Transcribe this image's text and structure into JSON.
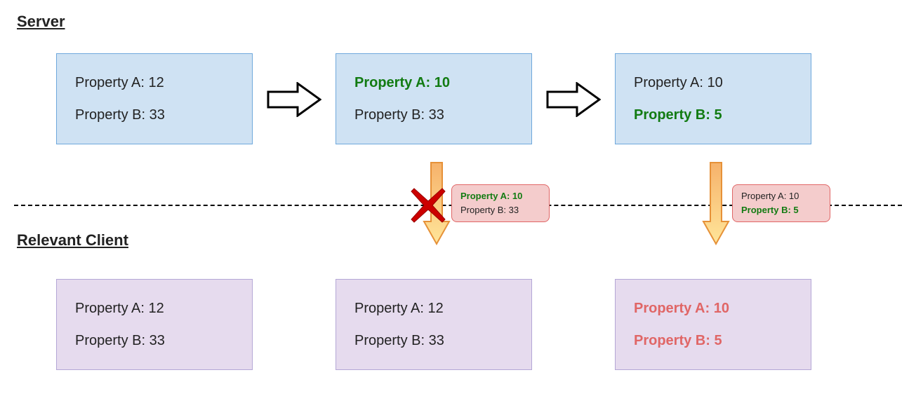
{
  "headings": {
    "server": "Server",
    "client": "Relevant Client"
  },
  "server": {
    "state1": {
      "a": "Property A: 12",
      "b": "Property B: 33"
    },
    "state2": {
      "a": "Property A: 10",
      "b": "Property B: 33"
    },
    "state3": {
      "a": "Property A: 10",
      "b": "Property B: 5"
    }
  },
  "client": {
    "state1": {
      "a": "Property A: 12",
      "b": "Property B: 33"
    },
    "state2": {
      "a": "Property A: 12",
      "b": "Property B: 33"
    },
    "state3": {
      "a": "Property A: 10",
      "b": "Property B: 5"
    }
  },
  "messages": {
    "msg1": {
      "a": "Property A: 10",
      "b": "Property B: 33"
    },
    "msg2": {
      "a": "Property A: 10",
      "b": "Property B: 5"
    }
  }
}
